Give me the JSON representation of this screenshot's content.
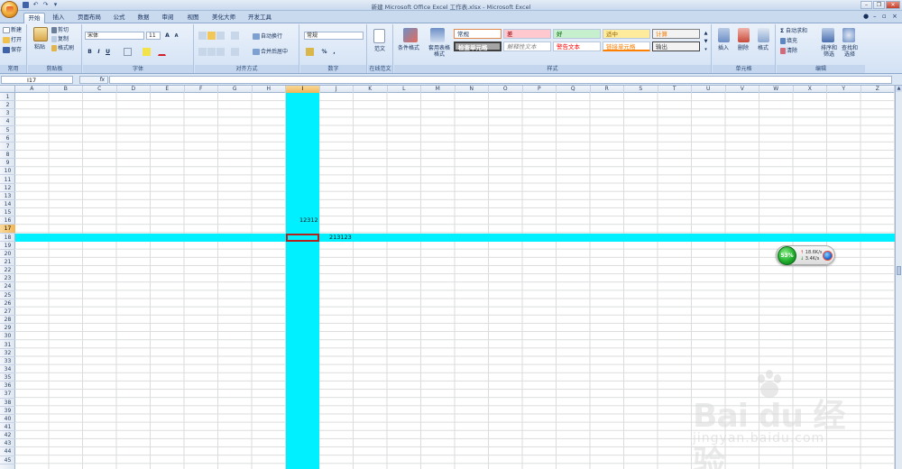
{
  "window": {
    "title": "新建 Microsoft Office Excel 工作表.xlsx - Microsoft Excel",
    "minimize": "–",
    "restore": "❐",
    "close": "✕"
  },
  "qat": {
    "save_icon": "save-icon",
    "undo": "↶",
    "redo": "↷",
    "more": "▾"
  },
  "tabs": [
    "开始",
    "插入",
    "页面布局",
    "公式",
    "数据",
    "审阅",
    "视图",
    "美化大师",
    "开发工具"
  ],
  "active_tab": "开始",
  "ribbon": {
    "common": {
      "new": "新建",
      "open": "打开",
      "save": "保存",
      "label": "常用"
    },
    "clipboard": {
      "paste": "粘贴",
      "cut": "剪切",
      "copy": "复制",
      "format_painter": "格式刷",
      "label": "剪贴板"
    },
    "font": {
      "name": "宋体",
      "size": "11",
      "grow": "A",
      "shrink": "A",
      "bold": "B",
      "italic": "I",
      "underline": "U",
      "label": "字体"
    },
    "alignment": {
      "wrap": "自动换行",
      "merge": "合并后居中",
      "label": "对齐方式"
    },
    "number": {
      "format": "常规",
      "percent": "%",
      "comma": ",",
      "label": "数字"
    },
    "online": {
      "fanwen": "范文",
      "label": "在线范文"
    },
    "styles": {
      "conditional": "条件格式",
      "table": "套用表格格式",
      "normal": "常规",
      "bad": "差",
      "good": "好",
      "neutral": "适中",
      "calc": "计算",
      "check": "检查单元格",
      "explain": "解释性文本",
      "warn": "警告文本",
      "linked": "链接单元格",
      "output": "输出",
      "label": "样式"
    },
    "cells": {
      "insert": "插入",
      "delete": "删除",
      "format": "格式",
      "label": "单元格"
    },
    "editing": {
      "autosum": "自动求和",
      "fill": "填充",
      "clear": "清除",
      "sort": "排序和筛选",
      "find": "查找和选择",
      "label": "编辑"
    }
  },
  "formula_bar": {
    "name_box": "I17",
    "fx": "fx",
    "content": ""
  },
  "columns": [
    "A",
    "B",
    "C",
    "D",
    "E",
    "F",
    "G",
    "H",
    "I",
    "J",
    "K",
    "L",
    "M",
    "N",
    "O",
    "P",
    "Q",
    "R",
    "S",
    "T",
    "U",
    "V",
    "W",
    "X",
    "Y",
    "Z"
  ],
  "selected_column": "I",
  "selected_row": "17",
  "cells": {
    "I15": "12312",
    "J17": "213123"
  },
  "colors": {
    "highlight": "#00f0ff",
    "selection_border": "#b3211c"
  },
  "widget": {
    "percent": "53%",
    "upload": "18.6K/s",
    "download": "3.4K/s"
  },
  "watermark": {
    "main": "Bai du 经验",
    "sub": "jingyan.baidu.com"
  }
}
